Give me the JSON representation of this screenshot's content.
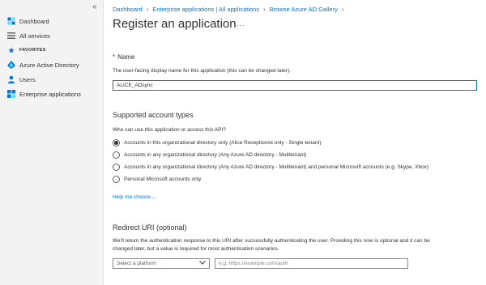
{
  "sidebar": {
    "collapse_icon": "«",
    "items": [
      {
        "label": "Dashboard",
        "icon": "dashboard-icon"
      },
      {
        "label": "All services",
        "icon": "list-icon"
      },
      {
        "label": "FAVORITES",
        "icon": "star-icon"
      },
      {
        "label": "Azure Active Directory",
        "icon": "azure-ad-icon"
      },
      {
        "label": "Users",
        "icon": "users-icon"
      },
      {
        "label": "Enterprise applications",
        "icon": "apps-icon"
      }
    ]
  },
  "breadcrumb": [
    "Dashboard",
    "Enterprise applications | All applications",
    "Browse Azure AD Gallery"
  ],
  "page": {
    "title": "Register an application",
    "more": "..."
  },
  "name_section": {
    "required_mark": "*",
    "label": "Name",
    "help": "The user-facing display name for this application (this can be changed later).",
    "value": "ALICE_ADsync"
  },
  "account_types": {
    "heading": "Supported account types",
    "question": "Who can use this application or access this API?",
    "options": [
      {
        "label": "Accounts in this organizational directory only (Alice Receptionist only - Single tenant)",
        "checked": true
      },
      {
        "label": "Accounts in any organizational directory (Any Azure AD directory - Multitenant)",
        "checked": false
      },
      {
        "label": "Accounts in any organizational directory (Any Azure AD directory - Multitenant) and personal Microsoft accounts (e.g. Skype, Xbox)",
        "checked": false
      },
      {
        "label": "Personal Microsoft accounts only",
        "checked": false
      }
    ],
    "help_link": "Help me choose..."
  },
  "redirect": {
    "heading": "Redirect URI (optional)",
    "help_line1": "We'll return the authentication response to this URI after successfully authenticating the user. Providing this now is optional and it can be",
    "help_line2": "changed later, but a value is required for most authentication scenarios.",
    "platform_placeholder": "Select a platform",
    "uri_placeholder": "e.g. https://example.com/auth"
  },
  "colors": {
    "accent": "#0078d4",
    "sidebar_bg": "#f3f3f3",
    "required": "#a4262c"
  }
}
